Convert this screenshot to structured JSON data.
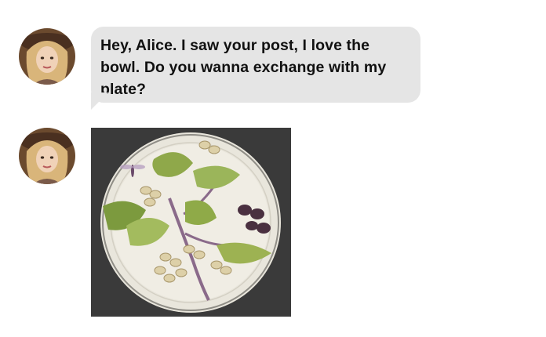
{
  "conversation": {
    "messages": [
      {
        "type": "text",
        "text": "Hey, Alice. I saw your post, I love the bowl. Do you wanna exchange with my plate?"
      },
      {
        "type": "image",
        "image_description": "porcelain plate painted with pistachio branch"
      }
    ]
  },
  "colors": {
    "bubble_bg": "#e5e5e5",
    "text": "#111111",
    "photo_bg": "#3a3a3a"
  }
}
